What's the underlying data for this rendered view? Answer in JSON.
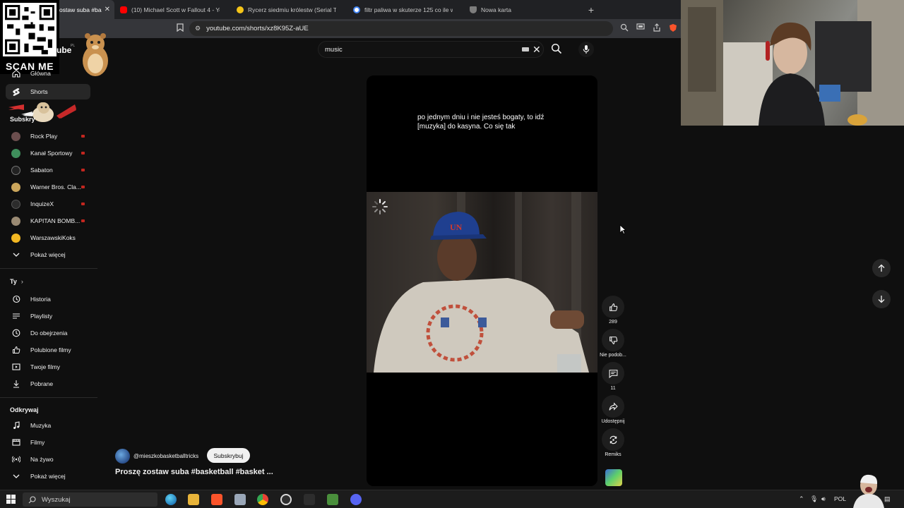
{
  "browser": {
    "tabs": [
      {
        "label": "ostaw suba #bas",
        "active": true,
        "color": "#ff0000"
      },
      {
        "label": "(10) Michael Scott w Fallout 4 - YouT",
        "active": false,
        "color": "#ff0000"
      },
      {
        "label": "Rycerz siedmiu królestw (Serial TV 20",
        "active": false,
        "color": "#f5c518"
      },
      {
        "label": "filtr paliwa w skuterze 125 co ile wym",
        "active": false,
        "color": "#4285f4"
      },
      {
        "label": "Nowa karta",
        "active": false,
        "color": "#aaaaaa"
      }
    ],
    "new_tab": "+",
    "close_tab": "✕",
    "url": "youtube.com/shorts/xz8K95Z-aUE"
  },
  "overlay": {
    "scan_me": "SCAN ME"
  },
  "youtube": {
    "logo_fragment": "ube",
    "logo_region": "PL",
    "search": {
      "value": "music"
    },
    "sidebar": {
      "top_items": [
        {
          "label": "Główna",
          "icon": "home-icon"
        },
        {
          "label": "Shorts",
          "icon": "shorts-icon",
          "active": true
        }
      ],
      "subscriptions_heading": "Subskry",
      "subscriptions": [
        {
          "label": "Rock Play",
          "color": "#6b4e4e"
        },
        {
          "label": "Kanał Sportowy",
          "color": "#3f8f5c"
        },
        {
          "label": "Sabaton",
          "color": "#222222"
        },
        {
          "label": "Warner Bros. Cla...",
          "color": "#caa55b"
        },
        {
          "label": "InquizeX",
          "color": "#2c2c2c"
        },
        {
          "label": "KAPITAN BOMB...",
          "color": "#9a8a73"
        },
        {
          "label": "WarszawskiKoks",
          "color": "#f2b722"
        }
      ],
      "show_more": "Pokaż więcej",
      "you_heading": "Ty",
      "you_items": [
        {
          "label": "Historia",
          "icon": "history-icon"
        },
        {
          "label": "Playlisty",
          "icon": "playlist-icon"
        },
        {
          "label": "Do obejrzenia",
          "icon": "clock-icon"
        },
        {
          "label": "Polubione filmy",
          "icon": "thumb-up-icon"
        },
        {
          "label": "Twoje filmy",
          "icon": "video-icon"
        },
        {
          "label": "Pobrane",
          "icon": "download-icon"
        }
      ],
      "explore_heading": "Odkrywaj",
      "explore_items": [
        {
          "label": "Muzyka",
          "icon": "music-icon"
        },
        {
          "label": "Filmy",
          "icon": "film-icon"
        },
        {
          "label": "Na żywo",
          "icon": "live-icon"
        },
        {
          "label": "Pokaż więcej",
          "icon": "chevron-down-icon"
        }
      ]
    },
    "short": {
      "caption": "po jednym dniu i nie jesteś bogaty, to idź [muzyka] do kasyna. Co się tak",
      "hat_text": "UN",
      "channel": "@mieszkobasketballtricks",
      "subscribe": "Subskrybuj",
      "title": "Proszę zostaw suba #basketball #basket ...",
      "actions": [
        {
          "label": "289",
          "icon": "thumb-up-icon"
        },
        {
          "label": "Nie podob...",
          "icon": "thumb-down-icon"
        },
        {
          "label": "11",
          "icon": "comment-icon"
        },
        {
          "label": "Udostępnij",
          "icon": "share-icon"
        },
        {
          "label": "Remiks",
          "icon": "remix-icon"
        }
      ]
    }
  },
  "taskbar": {
    "search_placeholder": "Wyszukaj",
    "language": "POL"
  }
}
